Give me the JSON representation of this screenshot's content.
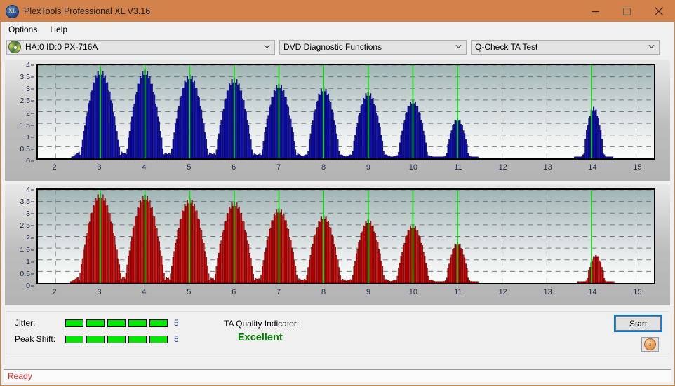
{
  "window": {
    "title": "PlexTools Professional XL V3.16",
    "app_icon": "xl-disc-icon",
    "icon_text": "XL",
    "minimize_label": "minimize",
    "maximize_label": "maximize",
    "close_label": "close",
    "titlebar_color": "#d2824a"
  },
  "menu": {
    "items": [
      {
        "label": "Options"
      },
      {
        "label": "Help"
      }
    ]
  },
  "toolbar": {
    "drive": {
      "icon": "cd-disc-icon",
      "value": "HA:0 ID:0  PX-716A"
    },
    "function": {
      "value": "DVD Diagnostic Functions"
    },
    "test": {
      "value": "Q-Check TA Test"
    }
  },
  "metrics": {
    "jitter": {
      "label": "Jitter:",
      "value": "5",
      "filled": 5,
      "total": 5
    },
    "peak_shift": {
      "label": "Peak Shift:",
      "value": "5",
      "filled": 5,
      "total": 5
    },
    "quality": {
      "label": "TA Quality Indicator:",
      "value": "Excellent",
      "color": "#008000"
    }
  },
  "actions": {
    "start_label": "Start",
    "info_label": "i"
  },
  "status": {
    "text": "Ready"
  },
  "chart_data": [
    {
      "type": "bar",
      "title": "Jitter TA Test (upper plot)",
      "series_name": "Jitter",
      "color": "#1414d2",
      "marker_color": "#00e400",
      "xlabel": "",
      "ylabel": "",
      "xlim": [
        1.6,
        15.4
      ],
      "ylim": [
        0,
        4
      ],
      "yticks": [
        0,
        0.5,
        1,
        1.5,
        2,
        2.5,
        3,
        3.5,
        4
      ],
      "ytick_labels": [
        "0",
        "0.5",
        "1",
        "1.5",
        "2",
        "2.5",
        "3",
        "3.5",
        "4"
      ],
      "xticks": [
        2,
        3,
        4,
        5,
        6,
        7,
        8,
        9,
        10,
        11,
        12,
        13,
        14,
        15
      ],
      "xtick_labels": [
        "2",
        "3",
        "4",
        "5",
        "6",
        "7",
        "8",
        "9",
        "10",
        "11",
        "12",
        "13",
        "14",
        "15"
      ],
      "grid": true,
      "markers": [
        3,
        4,
        5,
        6,
        7,
        8,
        9,
        10,
        11,
        14
      ],
      "clusters": [
        {
          "center": 3.0,
          "peak": 3.8,
          "half_width": 0.46,
          "floor": 0.35
        },
        {
          "center": 4.0,
          "peak": 3.8,
          "half_width": 0.42,
          "floor": 0.3
        },
        {
          "center": 5.0,
          "peak": 3.6,
          "half_width": 0.42,
          "floor": 0.3
        },
        {
          "center": 6.0,
          "peak": 3.45,
          "half_width": 0.42,
          "floor": 0.25
        },
        {
          "center": 7.0,
          "peak": 3.2,
          "half_width": 0.4,
          "floor": 0.25
        },
        {
          "center": 8.0,
          "peak": 3.05,
          "half_width": 0.38,
          "floor": 0.2
        },
        {
          "center": 9.0,
          "peak": 2.85,
          "half_width": 0.36,
          "floor": 0.2
        },
        {
          "center": 10.0,
          "peak": 2.5,
          "half_width": 0.34,
          "floor": 0.15
        },
        {
          "center": 11.0,
          "peak": 1.72,
          "half_width": 0.26,
          "floor": 0.1
        },
        {
          "center": 14.05,
          "peak": 2.2,
          "half_width": 0.24,
          "floor": 0.1
        }
      ]
    },
    {
      "type": "bar",
      "title": "Peak Shift TA Test (lower plot)",
      "series_name": "Peak Shift",
      "color": "#f01010",
      "marker_color": "#00e400",
      "xlabel": "",
      "ylabel": "",
      "xlim": [
        1.6,
        15.4
      ],
      "ylim": [
        0,
        4
      ],
      "yticks": [
        0,
        0.5,
        1,
        1.5,
        2,
        2.5,
        3,
        3.5,
        4
      ],
      "ytick_labels": [
        "0",
        "0.5",
        "1",
        "1.5",
        "2",
        "2.5",
        "3",
        "3.5",
        "4"
      ],
      "xticks": [
        2,
        3,
        4,
        5,
        6,
        7,
        8,
        9,
        10,
        11,
        12,
        13,
        14,
        15
      ],
      "xtick_labels": [
        "2",
        "3",
        "4",
        "5",
        "6",
        "7",
        "8",
        "9",
        "10",
        "11",
        "12",
        "13",
        "14",
        "15"
      ],
      "grid": true,
      "markers": [
        3,
        4,
        5,
        6,
        7,
        8,
        9,
        10,
        11,
        14
      ],
      "clusters": [
        {
          "center": 3.0,
          "peak": 3.85,
          "half_width": 0.47,
          "floor": 0.32
        },
        {
          "center": 4.0,
          "peak": 3.78,
          "half_width": 0.45,
          "floor": 0.3
        },
        {
          "center": 5.0,
          "peak": 3.62,
          "half_width": 0.44,
          "floor": 0.28
        },
        {
          "center": 6.0,
          "peak": 3.5,
          "half_width": 0.44,
          "floor": 0.26
        },
        {
          "center": 7.0,
          "peak": 3.2,
          "half_width": 0.42,
          "floor": 0.24
        },
        {
          "center": 8.0,
          "peak": 2.9,
          "half_width": 0.4,
          "floor": 0.22
        },
        {
          "center": 9.0,
          "peak": 2.72,
          "half_width": 0.38,
          "floor": 0.2
        },
        {
          "center": 10.0,
          "peak": 2.5,
          "half_width": 0.36,
          "floor": 0.18
        },
        {
          "center": 11.0,
          "peak": 1.75,
          "half_width": 0.27,
          "floor": 0.1
        },
        {
          "center": 14.1,
          "peak": 1.2,
          "half_width": 0.22,
          "floor": 0.08
        }
      ]
    }
  ]
}
